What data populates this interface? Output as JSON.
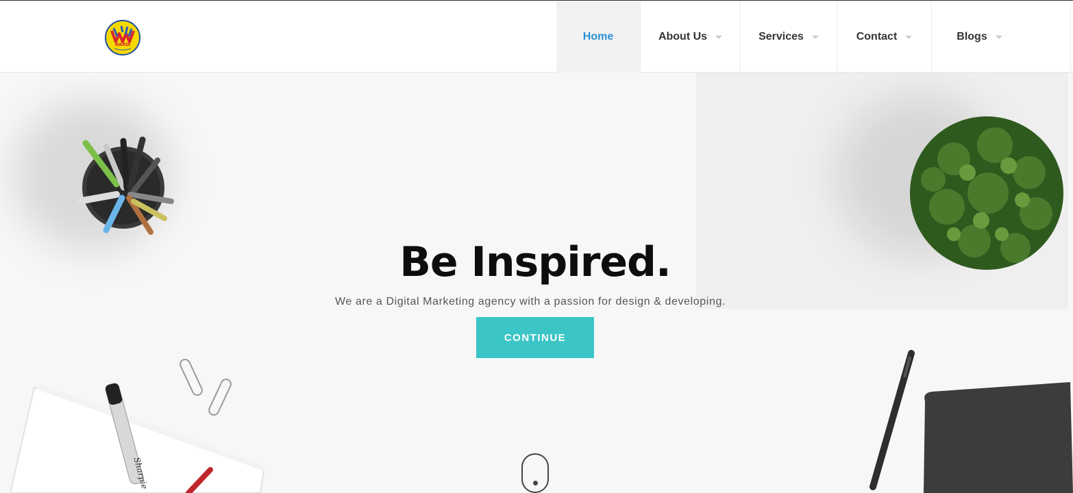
{
  "header": {
    "logo_icon": "wardi-logo-icon",
    "logo_text": "WARDI",
    "nav": [
      {
        "label": "Home",
        "active": true,
        "dropdown": false
      },
      {
        "label": "About Us",
        "active": false,
        "dropdown": true
      },
      {
        "label": "Services",
        "active": false,
        "dropdown": true
      },
      {
        "label": "Contact",
        "active": false,
        "dropdown": true
      },
      {
        "label": "Blogs",
        "active": false,
        "dropdown": true
      }
    ]
  },
  "hero": {
    "title": "Be Inspired.",
    "subtitle": "We are a Digital Marketing agency with a passion for design & developing.",
    "cta_label": "CONTINUE",
    "scroll_icon": "mouse-scroll-icon",
    "decor": [
      "pen-holder-image",
      "plant-image",
      "notebook-marker-image",
      "paperclips-image",
      "stylus-image",
      "tablet-image"
    ]
  },
  "colors": {
    "accent": "#3cc5c7",
    "nav_active": "#2a8fd6",
    "title": "#0d0d0d",
    "background": "#f7f7f7"
  }
}
